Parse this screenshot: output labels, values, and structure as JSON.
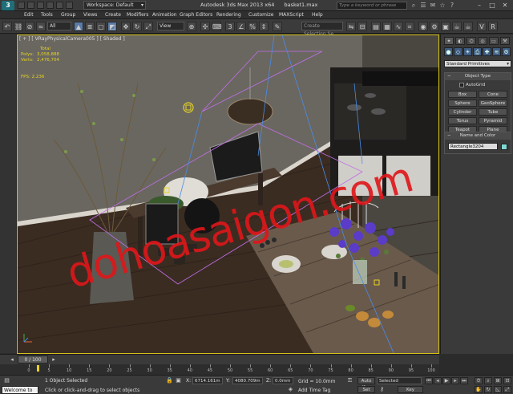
{
  "titlebar": {
    "workspace_label": "Workspace: Default",
    "app_title": "Autodesk 3ds Max  2013 x64",
    "file_name": "basket1.max",
    "search_placeholder": "Type a keyword or phrase"
  },
  "menu": {
    "items": [
      "Edit",
      "Tools",
      "Group",
      "Views",
      "Create",
      "Modifiers",
      "Animation",
      "Graph Editors",
      "Rendering",
      "Customize",
      "MAXScript",
      "Help"
    ]
  },
  "toolbar": {
    "filter_value": "All",
    "refcoord_value": "View",
    "selection_set_placeholder": "Create Selection Se"
  },
  "viewport": {
    "label": "[ + ] [ VRayPhysicalCamera005 ] [ Shaded ]",
    "stats_header": "Total",
    "polys_label": "Polys:",
    "polys_value": "3,058,888",
    "verts_label": "Verts:",
    "verts_value": "2,476,704",
    "fps_label": "FPS:",
    "fps_value": "2.236",
    "watermark": "dohoasaigon.com"
  },
  "command_panel": {
    "category_select": "Standard Primitives",
    "object_type_title": "Object Type",
    "autogrid_label": "AutoGrid",
    "object_buttons": [
      "Box",
      "Cone",
      "Sphere",
      "GeoSphere",
      "Cylinder",
      "Tube",
      "Torus",
      "Pyramid",
      "Teapot",
      "Plane"
    ],
    "name_color_title": "Name and Color",
    "object_name": "Rectangle3204",
    "object_color": "#7fd9d2"
  },
  "time_slider": {
    "frame_label": "0 / 100",
    "ticks": [
      "0",
      "5",
      "10",
      "15",
      "20",
      "25",
      "30",
      "35",
      "40",
      "45",
      "50",
      "55",
      "60",
      "65",
      "70",
      "75",
      "80",
      "85",
      "90",
      "95",
      "100"
    ]
  },
  "status": {
    "maxscript_text": "Welcome to M",
    "selection_status": "1 Object Selected",
    "prompt": "Click or click-and-drag to select objects",
    "x_label": "X:",
    "x_value": "6714.161m",
    "y_label": "Y:",
    "y_value": "4080.709m",
    "z_label": "Z:",
    "z_value": "0.0mm",
    "grid_label": "Grid = 10.0mm",
    "add_time_tag": "Add Time Tag",
    "autokey_label": "Auto Key",
    "selected_value": "Selected",
    "setkey_label": "Set Key",
    "keyfilters_label": "Key Filters..."
  },
  "colors": {
    "viewport_border": "#d4c21a",
    "stats_text": "#e6d324",
    "watermark": "#e0161a"
  }
}
